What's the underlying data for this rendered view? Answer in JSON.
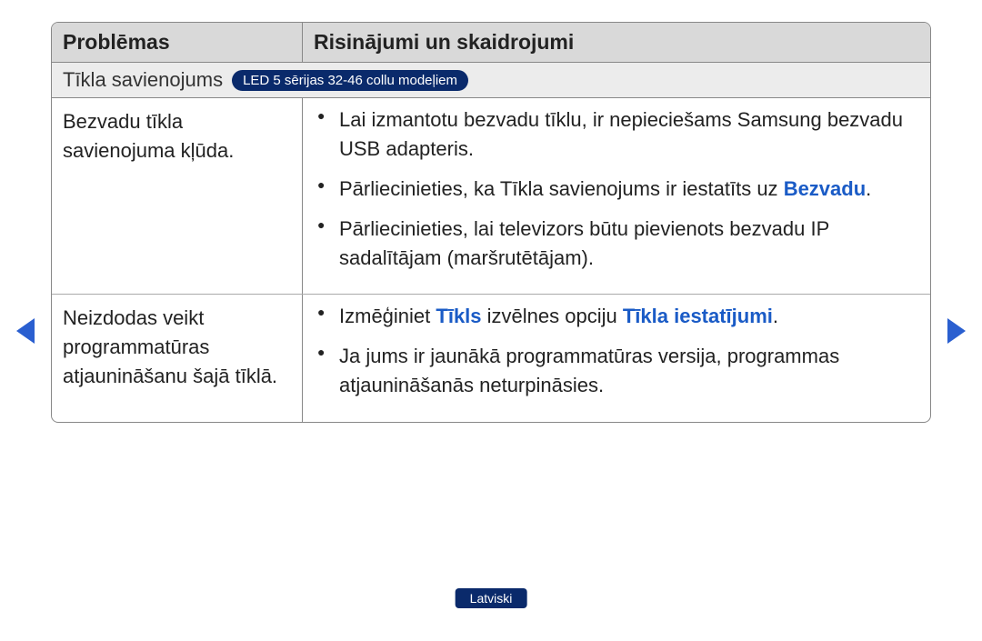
{
  "header": {
    "col1": "Problēmas",
    "col2": "Risinājumi un skaidrojumi"
  },
  "section": {
    "title": "Tīkla savienojums",
    "badge": "LED 5 sērijas 32-46 collu modeļiem"
  },
  "rows": [
    {
      "problem": "Bezvadu tīkla savienojuma kļūda.",
      "solutions": [
        {
          "pre": "Lai izmantotu bezvadu tīklu, ir nepieciešams Samsung bezvadu USB adapteris."
        },
        {
          "pre": "Pārliecinieties, ka Tīkla savienojums ir iestatīts uz ",
          "blue": "Bezvadu",
          "post": "."
        },
        {
          "pre": "Pārliecinieties, lai televizors būtu pievienots bezvadu IP sadalītājam (maršrutētājam)."
        }
      ]
    },
    {
      "problem": "Neizdodas veikt programmatūras atjaunināšanu šajā tīklā.",
      "solutions": [
        {
          "pre": "Izmēģiniet ",
          "blue": "Tīkls",
          "mid": " izvēlnes opciju ",
          "blue2": "Tīkla iestatījumi",
          "post": "."
        },
        {
          "pre": "Ja jums ir jaunākā programmatūras versija, programmas atjaunināšanās neturpināsies."
        }
      ]
    }
  ],
  "language": "Latviski"
}
